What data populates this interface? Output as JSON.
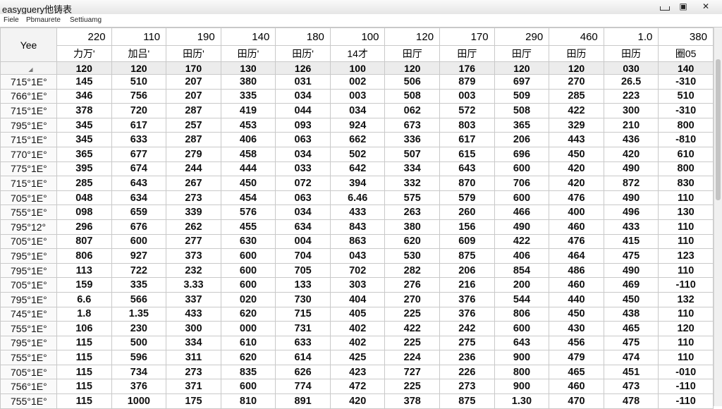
{
  "window": {
    "title": "easyguery他铸表",
    "min": "",
    "max": "▣",
    "close": "✕"
  },
  "menu": [
    "Fiele",
    "Pbmaurete",
    "Settiuamg"
  ],
  "table": {
    "corner": "Yee",
    "header_top": [
      "220",
      "110",
      "190",
      "140",
      "180",
      "100",
      "120",
      "170",
      "290",
      "460",
      "1.0",
      "380"
    ],
    "header_mid": [
      "力万ʹ",
      "加吕ʹ",
      "田历ʹ",
      "田历ʹ",
      "田历ʹ",
      "14才",
      "田厅",
      "田厅",
      "田厅",
      "田历",
      "田历",
      "圈05"
    ],
    "header_bottom": [
      "120",
      "120",
      "170",
      "130",
      "126",
      "100",
      "120",
      "176",
      "120",
      "120",
      "030",
      "140"
    ],
    "rows": [
      {
        "h": "715°1E°",
        "v": [
          "145",
          "510",
          "207",
          "380",
          "031",
          "002",
          "506",
          "879",
          "697",
          "270",
          "26.5",
          "-310"
        ]
      },
      {
        "h": "766°1E°",
        "v": [
          "346",
          "756",
          "207",
          "335",
          "034",
          "003",
          "508",
          "003",
          "509",
          "285",
          "223",
          "510"
        ]
      },
      {
        "h": "715°1E°",
        "v": [
          "378",
          "720",
          "287",
          "419",
          "044",
          "034",
          "062",
          "572",
          "508",
          "422",
          "300",
          "-310"
        ]
      },
      {
        "h": "795°1E°",
        "v": [
          "345",
          "617",
          "257",
          "453",
          "093",
          "924",
          "673",
          "803",
          "365",
          "329",
          "210",
          "800"
        ]
      },
      {
        "h": "715°1E°",
        "v": [
          "345",
          "633",
          "287",
          "406",
          "063",
          "662",
          "336",
          "617",
          "206",
          "443",
          "436",
          "-810"
        ]
      },
      {
        "h": "770°1E°",
        "v": [
          "365",
          "677",
          "279",
          "458",
          "034",
          "502",
          "507",
          "615",
          "696",
          "450",
          "420",
          "610"
        ]
      },
      {
        "h": "775°1E°",
        "v": [
          "395",
          "674",
          "244",
          "444",
          "033",
          "642",
          "334",
          "643",
          "600",
          "420",
          "490",
          "800"
        ]
      },
      {
        "h": "715°1E°",
        "v": [
          "285",
          "643",
          "267",
          "450",
          "072",
          "394",
          "332",
          "870",
          "706",
          "420",
          "872",
          "830"
        ]
      },
      {
        "h": "705°1E°",
        "v": [
          "048",
          "634",
          "273",
          "454",
          "063",
          "6.46",
          "575",
          "579",
          "600",
          "476",
          "490",
          "110"
        ]
      },
      {
        "h": "755°1E°",
        "v": [
          "098",
          "659",
          "339",
          "576",
          "034",
          "433",
          "263",
          "260",
          "466",
          "400",
          "496",
          "130"
        ]
      },
      {
        "h": "795°12°",
        "v": [
          "296",
          "676",
          "262",
          "455",
          "634",
          "843",
          "380",
          "156",
          "490",
          "460",
          "433",
          "110"
        ]
      },
      {
        "h": "705°1E°",
        "v": [
          "807",
          "600",
          "277",
          "630",
          "004",
          "863",
          "620",
          "609",
          "422",
          "476",
          "415",
          "110"
        ]
      },
      {
        "h": "795°1E°",
        "v": [
          "806",
          "927",
          "373",
          "600",
          "704",
          "043",
          "530",
          "875",
          "406",
          "464",
          "475",
          "123"
        ]
      },
      {
        "h": "795°1E°",
        "v": [
          "113",
          "722",
          "232",
          "600",
          "705",
          "702",
          "282",
          "206",
          "854",
          "486",
          "490",
          "110"
        ]
      },
      {
        "h": "705°1E°",
        "v": [
          "159",
          "335",
          "3.33",
          "600",
          "133",
          "303",
          "276",
          "216",
          "200",
          "460",
          "469",
          "-110"
        ]
      },
      {
        "h": "795°1E°",
        "v": [
          "6.6",
          "566",
          "337",
          "020",
          "730",
          "404",
          "270",
          "376",
          "544",
          "440",
          "450",
          "132"
        ]
      },
      {
        "h": "745°1E°",
        "v": [
          "1.8",
          "1.35",
          "433",
          "620",
          "715",
          "405",
          "225",
          "376",
          "806",
          "450",
          "438",
          "110"
        ]
      },
      {
        "h": "755°1E°",
        "v": [
          "106",
          "230",
          "300",
          "000",
          "731",
          "402",
          "422",
          "242",
          "600",
          "430",
          "465",
          "120"
        ]
      },
      {
        "h": "795°1E°",
        "v": [
          "115",
          "500",
          "334",
          "610",
          "633",
          "402",
          "225",
          "275",
          "643",
          "456",
          "475",
          "110"
        ]
      },
      {
        "h": "755°1E°",
        "v": [
          "115",
          "596",
          "311",
          "620",
          "614",
          "425",
          "224",
          "236",
          "900",
          "479",
          "474",
          "110"
        ]
      },
      {
        "h": "705°1E°",
        "v": [
          "115",
          "734",
          "273",
          "835",
          "626",
          "423",
          "727",
          "226",
          "800",
          "465",
          "451",
          "-010"
        ]
      },
      {
        "h": "756°1E°",
        "v": [
          "115",
          "376",
          "371",
          "600",
          "774",
          "472",
          "225",
          "273",
          "900",
          "460",
          "473",
          "-110"
        ]
      },
      {
        "h": "755°1E°",
        "v": [
          "115",
          "1000",
          "175",
          "810",
          "891",
          "420",
          "378",
          "875",
          "1.30",
          "470",
          "478",
          "-110"
        ]
      }
    ]
  }
}
